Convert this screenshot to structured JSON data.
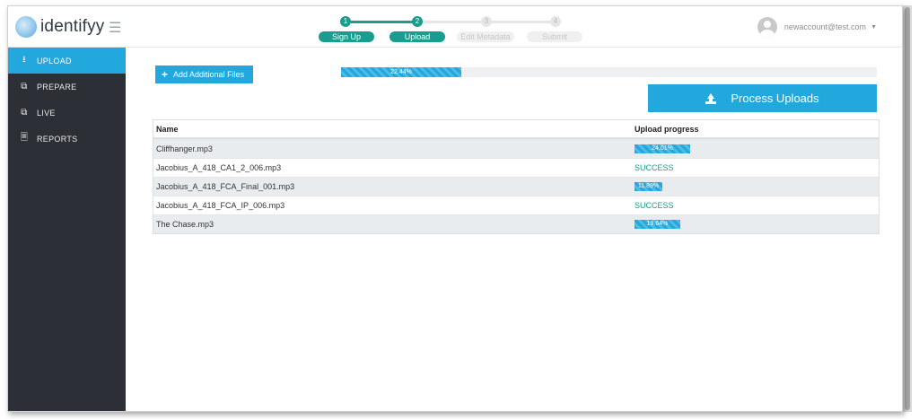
{
  "app": {
    "logo_text": "identifyy"
  },
  "stepper": {
    "steps": [
      {
        "number": "1",
        "label": "Sign Up"
      },
      {
        "number": "2",
        "label": "Upload"
      },
      {
        "number": "3",
        "label": "Edit Metadata"
      },
      {
        "number": "4",
        "label": "Submit"
      }
    ]
  },
  "user": {
    "email": "newaccount@test.com"
  },
  "sidebar": {
    "items": [
      {
        "label": "UPLOAD",
        "icon": "upload-icon"
      },
      {
        "label": "PREPARE",
        "icon": "copy-icon"
      },
      {
        "label": "LIVE",
        "icon": "copy-icon"
      },
      {
        "label": "REPORTS",
        "icon": "document-icon"
      }
    ]
  },
  "toolbar": {
    "add_files_label": "Add Additional Files",
    "overall_progress_text": "22.44%",
    "overall_progress": 0.2244,
    "process_label": "Process Uploads"
  },
  "table": {
    "headers": {
      "name": "Name",
      "progress": "Upload progress"
    },
    "rows": [
      {
        "name": "Cliffhanger.mp3",
        "status": "24.01%",
        "progress": 0.2401
      },
      {
        "name": "Jacobius_A_418_CA1_2_006.mp3",
        "status": "SUCCESS"
      },
      {
        "name": "Jacobius_A_418_FCA_Final_001.mp3",
        "status": "11.89%",
        "progress": 0.1189
      },
      {
        "name": "Jacobius_A_418_FCA_IP_006.mp3",
        "status": "SUCCESS"
      },
      {
        "name": "The Chase.mp3",
        "status": "19.64%",
        "progress": 0.1964
      }
    ]
  },
  "colors": {
    "accent": "#22a8dc",
    "step_done": "#1a9c8f",
    "sidebar": "#2c3036"
  }
}
